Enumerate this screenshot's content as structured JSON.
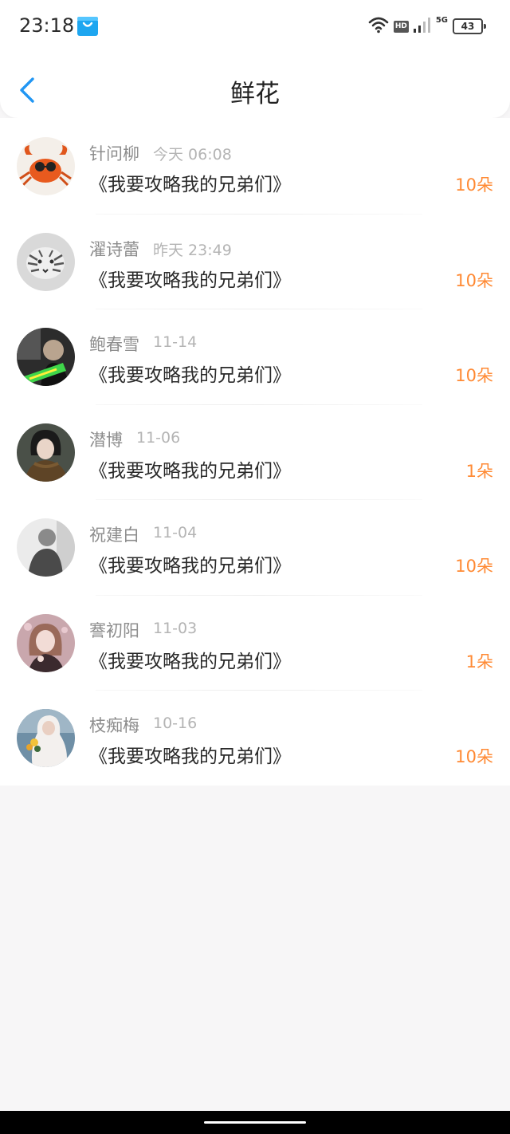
{
  "status_bar": {
    "time": "23:18",
    "network": "5G",
    "hd_label": "HD",
    "battery": "43"
  },
  "header": {
    "title": "鲜花"
  },
  "gifts": [
    {
      "name": "针问柳",
      "date": "今天 06:08",
      "book": "《我要攻略我的兄弟们》",
      "amount": "10朵",
      "avatar": "crab-avatar"
    },
    {
      "name": "濯诗蕾",
      "date": "昨天 23:49",
      "book": "《我要攻略我的兄弟们》",
      "amount": "10朵",
      "avatar": "tiger-avatar"
    },
    {
      "name": "鲍春雪",
      "date": "11-14",
      "book": "《我要攻略我的兄弟们》",
      "amount": "10朵",
      "avatar": "man-sticker-avatar"
    },
    {
      "name": "潜博",
      "date": "11-06",
      "book": "《我要攻略我的兄弟们》",
      "amount": "1朵",
      "avatar": "girl-scarf-avatar"
    },
    {
      "name": "祝建白",
      "date": "11-04",
      "book": "《我要攻略我的兄弟们》",
      "amount": "10朵",
      "avatar": "grey-figure-avatar"
    },
    {
      "name": "謇初阳",
      "date": "11-03",
      "book": "《我要攻略我的兄弟们》",
      "amount": "1朵",
      "avatar": "anime-girl-avatar"
    },
    {
      "name": "枝痴梅",
      "date": "10-16",
      "book": "《我要攻略我的兄弟们》",
      "amount": "10朵",
      "avatar": "bride-bouquet-avatar"
    }
  ],
  "colors": {
    "accent_blue": "#2196f3",
    "amount_orange": "#ff8a34",
    "name_gray": "#8d8d8d",
    "date_gray": "#b4b4b4",
    "background": "#f7f6f7"
  }
}
